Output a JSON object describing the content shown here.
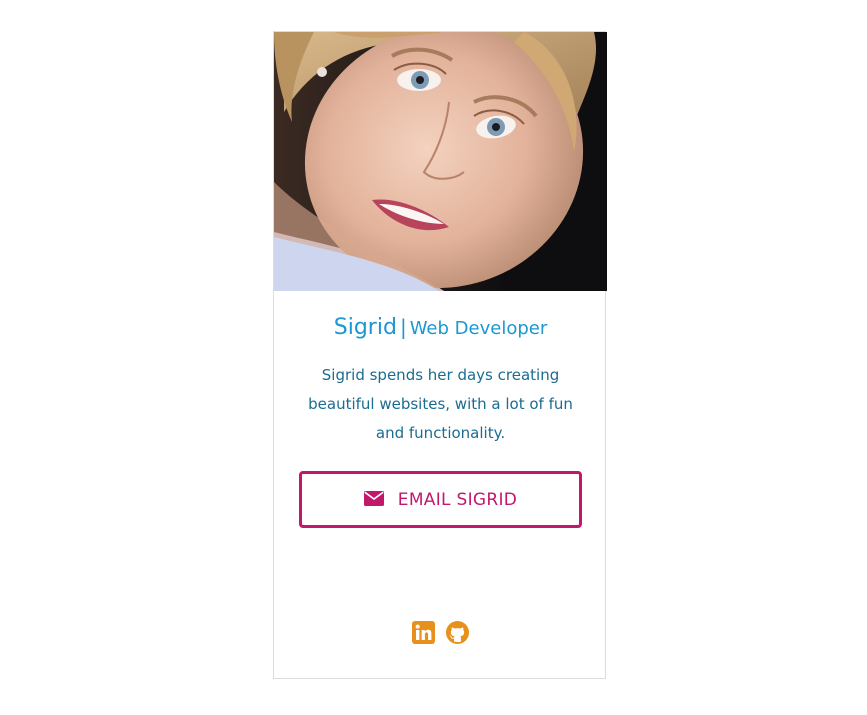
{
  "profile": {
    "name": "Sigrid",
    "separator": "|",
    "role": "Web Developer",
    "bio": "Sigrid spends her days creating beautiful websites, with a lot of fun and functionality.",
    "photo_alt": "Sigrid"
  },
  "actions": {
    "email_label": "EMAIL SIGRID",
    "email_icon": "envelope-icon"
  },
  "social": {
    "items": [
      {
        "icon": "linkedin-icon"
      },
      {
        "icon": "github-icon"
      }
    ]
  },
  "colors": {
    "title": "#1b98d1",
    "bio": "#1a6c91",
    "accent": "#c2186b",
    "social": "#e8901c",
    "card_border": "#dcdcdc"
  }
}
